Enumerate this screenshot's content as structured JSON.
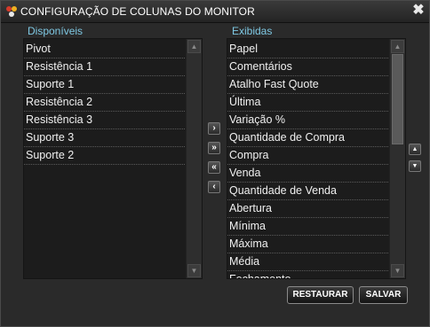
{
  "window": {
    "title": "CONFIGURAÇÃO DE COLUNAS DO MONITOR",
    "close_glyph": "✖"
  },
  "available": {
    "label": "Disponíveis",
    "items": [
      "Pivot",
      "Resistência 1",
      "Suporte 1",
      "Resistência 2",
      "Resistência 3",
      "Suporte 3",
      "Suporte 2"
    ]
  },
  "shown": {
    "label": "Exibidas",
    "items": [
      "Papel",
      "Comentários",
      "Atalho Fast Quote",
      "Última",
      "Variação %",
      "Quantidade de Compra",
      "Compra",
      "Venda",
      "Quantidade de Venda",
      "Abertura",
      "Mínima",
      "Máxima",
      "Média",
      "Fechamento"
    ]
  },
  "move_buttons": {
    "add_one": "›",
    "add_all": "»",
    "remove_all": "«",
    "remove_one": "‹"
  },
  "order_buttons": {
    "up": "▲",
    "down": "▼"
  },
  "scroll_glyphs": {
    "up": "▲",
    "down": "▼"
  },
  "actions": {
    "restore": "RESTAURAR",
    "save": "SALVAR"
  },
  "colors": {
    "accent": "#7ec8e3",
    "background": "#2a2a2a",
    "list_background": "#1c1c1c"
  }
}
